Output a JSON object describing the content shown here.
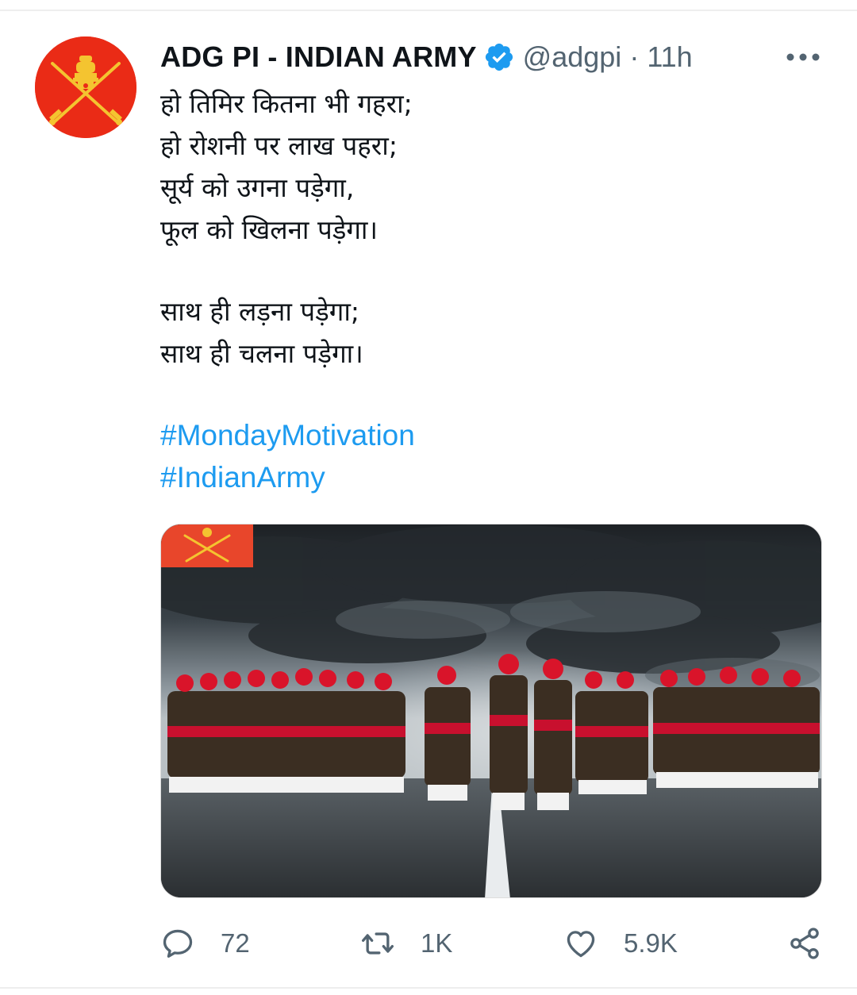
{
  "tweet": {
    "display_name": "ADG PI - INDIAN ARMY",
    "verified_icon": "verified-badge-icon",
    "handle": "@adgpi",
    "separator": "·",
    "time": "11h",
    "more_icon": "more-options-icon",
    "text_lines": [
      "हो तिमिर कितना भी गहरा;",
      "हो रोशनी पर लाख पहरा;",
      "सूर्य को उगना पड़ेगा,",
      "फूल को खिलना पड़ेगा।",
      "साथ ही लड़ना पड़ेगा;",
      "साथ ही चलना पड़ेगा।"
    ],
    "hashtags": [
      "#MondayMotivation",
      "#IndianArmy"
    ],
    "colors": {
      "accent": "#1d9bf0",
      "avatar_bg": "#ea2b16",
      "secondary_text": "#536471"
    }
  },
  "actions": {
    "reply": {
      "icon": "reply-icon",
      "count": "72"
    },
    "retweet": {
      "icon": "retweet-icon",
      "count": "1K"
    },
    "like": {
      "icon": "heart-icon",
      "count": "5.9K"
    },
    "share": {
      "icon": "share-icon"
    }
  }
}
